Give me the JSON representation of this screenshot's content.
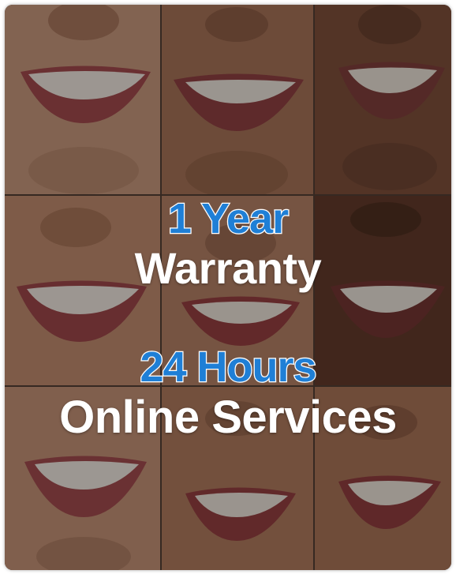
{
  "headline": {
    "line1": "1 Year",
    "line2": "Warranty",
    "line3": "24 Hours",
    "line4": "Online Services"
  },
  "colors": {
    "accent": "#1f7fd6",
    "text": "#ffffff"
  }
}
